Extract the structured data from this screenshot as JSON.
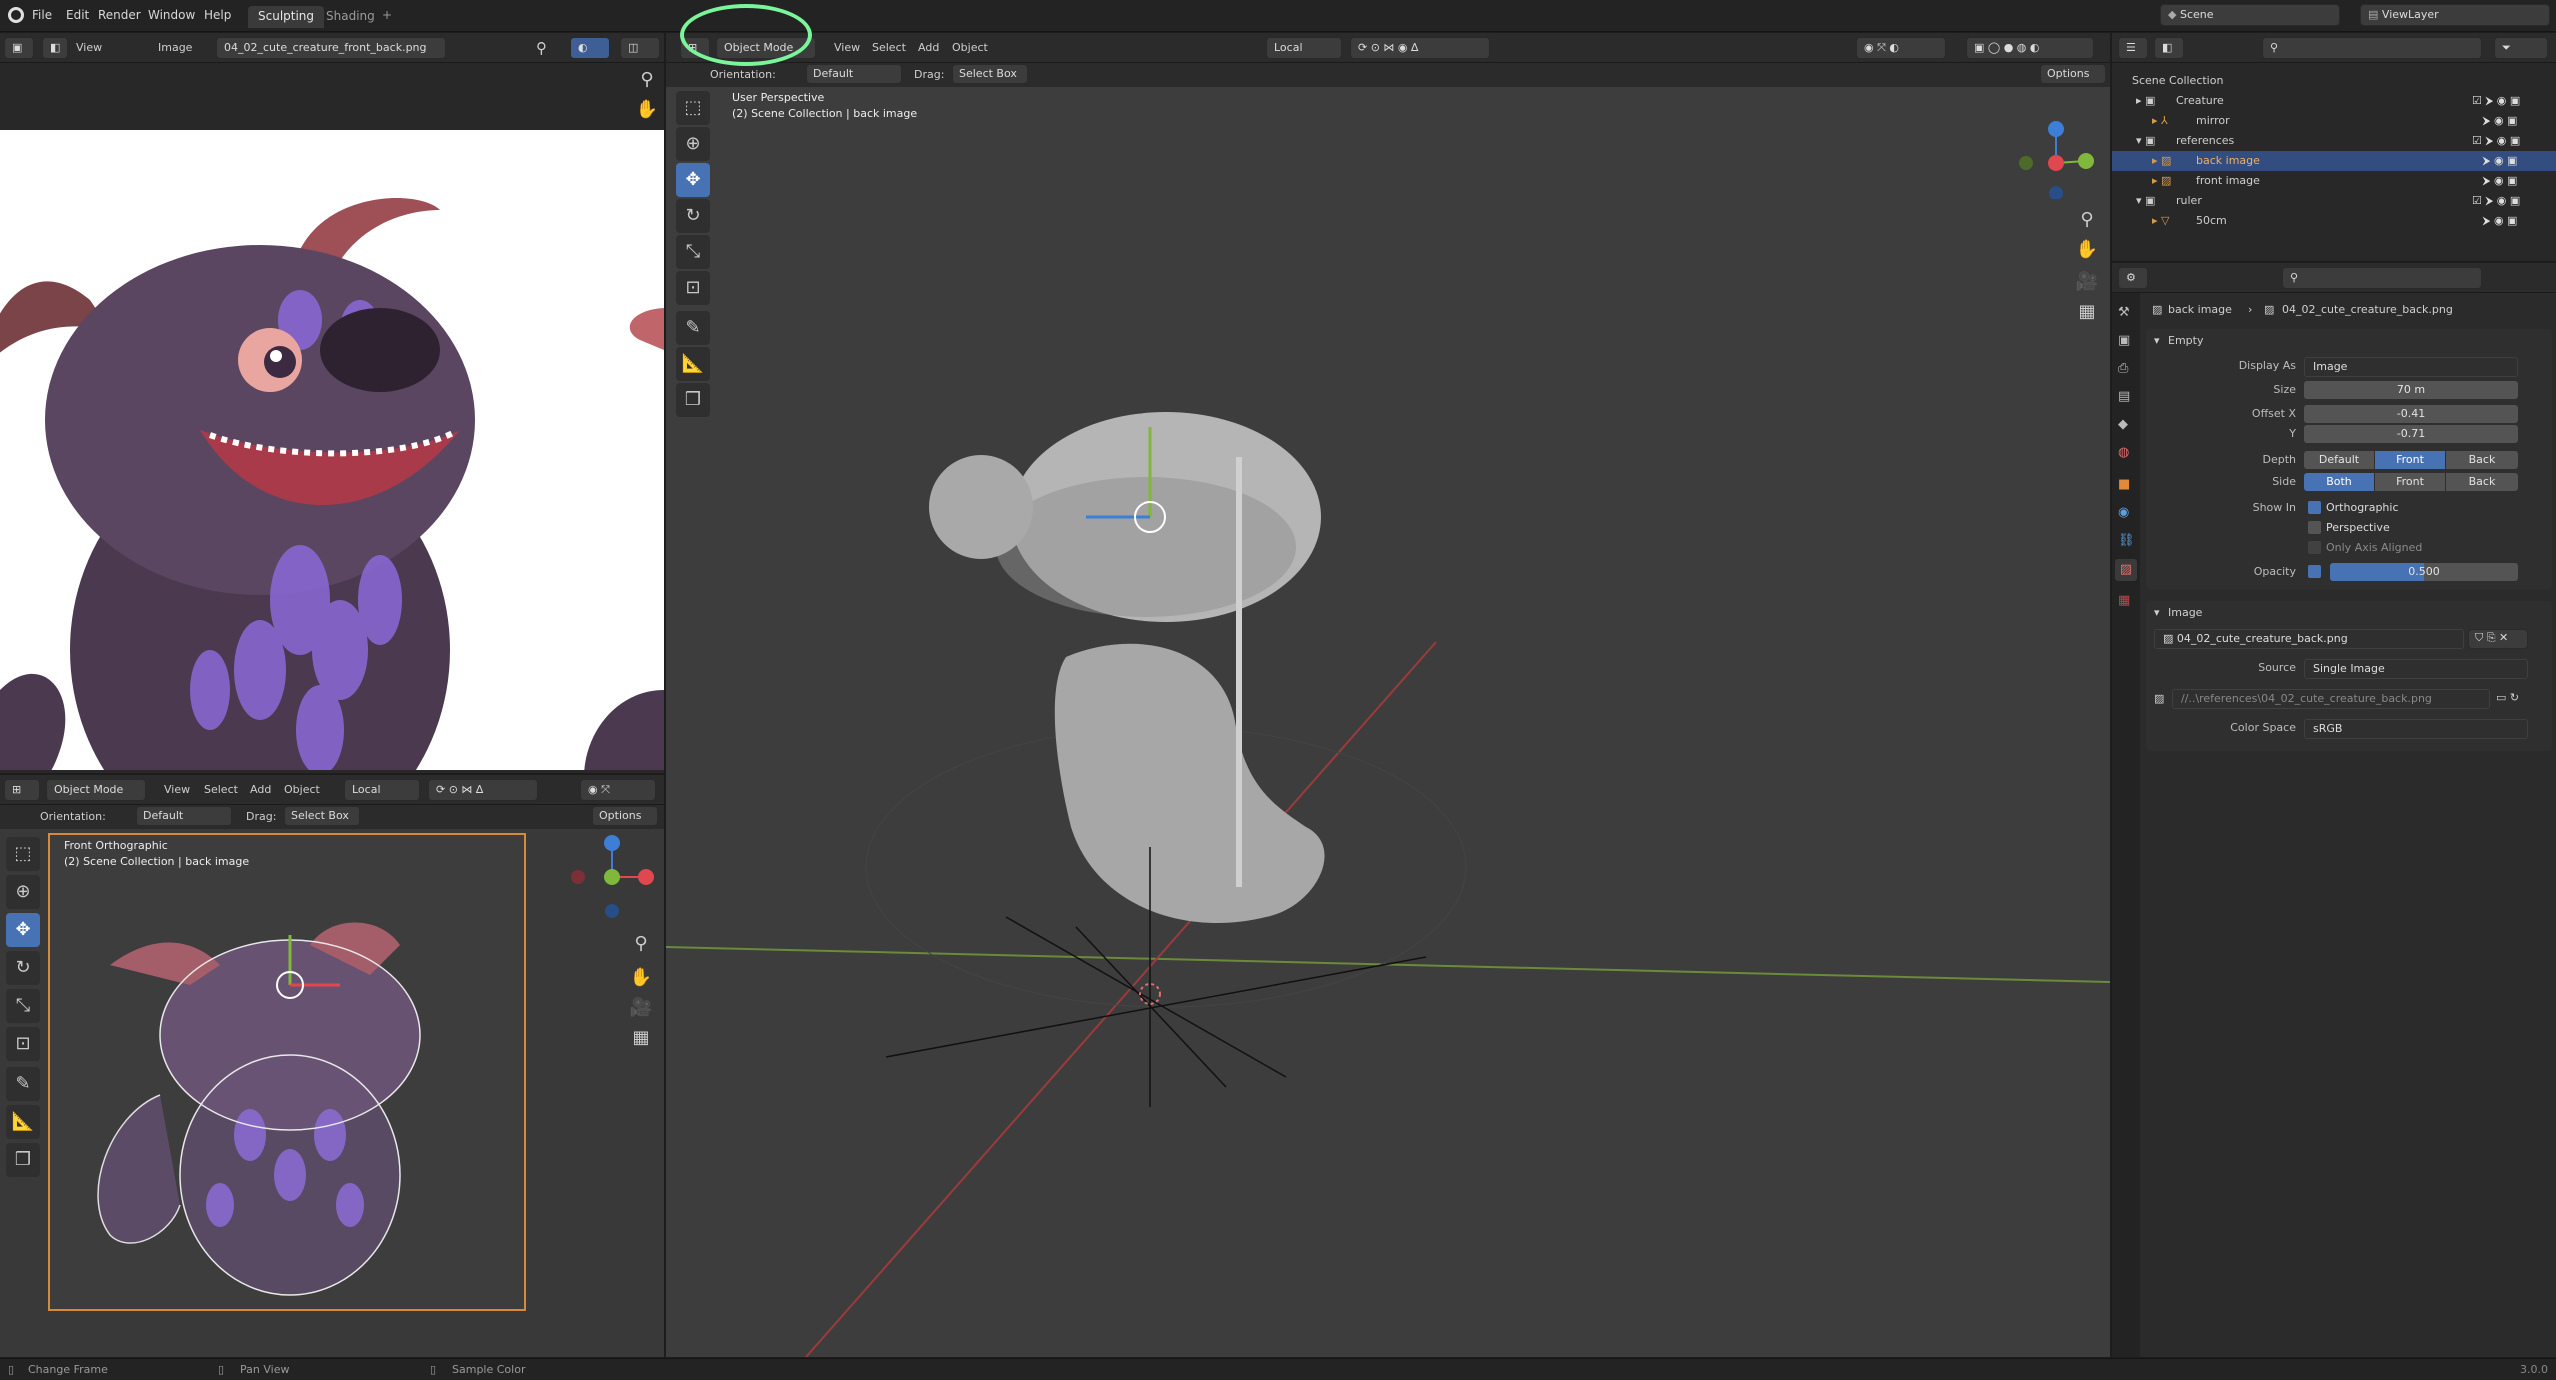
{
  "topbar": {
    "menus": [
      "File",
      "Edit",
      "Render",
      "Window",
      "Help"
    ],
    "tabs": [
      "Sculpting",
      "Shading"
    ],
    "add_tab": "+",
    "scene": "Scene",
    "view_layer": "ViewLayer"
  },
  "image_editor": {
    "view": "View",
    "image": "Image",
    "filename": "04_02_cute_creature_front_back.png"
  },
  "viewport_main": {
    "mode": "Object Mode",
    "menus": [
      "View",
      "Select",
      "Add",
      "Object"
    ],
    "transform": "Local",
    "orientation_label": "Orientation:",
    "orientation": "Default",
    "drag_label": "Drag:",
    "drag": "Select Box",
    "options": "Options",
    "view_name": "User Perspective",
    "collection": "(2) Scene Collection | back image"
  },
  "viewport_front": {
    "mode": "Object Mode",
    "menus": [
      "View",
      "Select",
      "Add",
      "Object"
    ],
    "transform": "Local",
    "orientation_label": "Orientation:",
    "orientation": "Default",
    "drag_label": "Drag:",
    "drag": "Select Box",
    "options": "Options",
    "view_name": "Front Orthographic",
    "collection": "(2) Scene Collection | back image"
  },
  "outliner": {
    "root": "Scene Collection",
    "items": [
      {
        "label": "Creature",
        "depth": 1
      },
      {
        "label": "mirror",
        "depth": 2
      },
      {
        "label": "references",
        "depth": 1
      },
      {
        "label": "back image",
        "depth": 2,
        "selected": true
      },
      {
        "label": "front image",
        "depth": 2
      },
      {
        "label": "ruler",
        "depth": 1
      },
      {
        "label": "50cm",
        "depth": 2
      }
    ]
  },
  "properties": {
    "breadcrumb_object": "back image",
    "breadcrumb_image": "04_02_cute_creature_back.png",
    "empty_section": "Empty",
    "display_as_label": "Display As",
    "display_as": "Image",
    "size_label": "Size",
    "size": "70 m",
    "offset_x_label": "Offset X",
    "offset_x": "-0.41",
    "offset_y_label": "Y",
    "offset_y": "-0.71",
    "depth_label": "Depth",
    "depth_options": [
      "Default",
      "Front",
      "Back"
    ],
    "depth_selected": "Front",
    "side_label": "Side",
    "side_options": [
      "Both",
      "Front",
      "Back"
    ],
    "side_selected": "Both",
    "show_in_label": "Show In",
    "orthographic": "Orthographic",
    "perspective": "Perspective",
    "only_axis_aligned": "Only Axis Aligned",
    "opacity_label": "Opacity",
    "opacity": "0.500",
    "opacity_fraction": 0.5,
    "image_section": "Image",
    "image_name": "04_02_cute_creature_back.png",
    "source_label": "Source",
    "source": "Single Image",
    "filepath": "//..\\references\\04_02_cute_creature_back.png",
    "color_space_label": "Color Space",
    "color_space": "sRGB"
  },
  "statusbar": {
    "items": [
      "Change Frame",
      "Pan View",
      "Sample Color"
    ],
    "version": "3.0.0"
  },
  "colors": {
    "accent": "#4772b3",
    "annotation": "#7bf59a",
    "selected_row": "#334d80",
    "x_axis": "#e0474f",
    "y_axis": "#7fb83a",
    "z_axis": "#3d7fd6"
  }
}
